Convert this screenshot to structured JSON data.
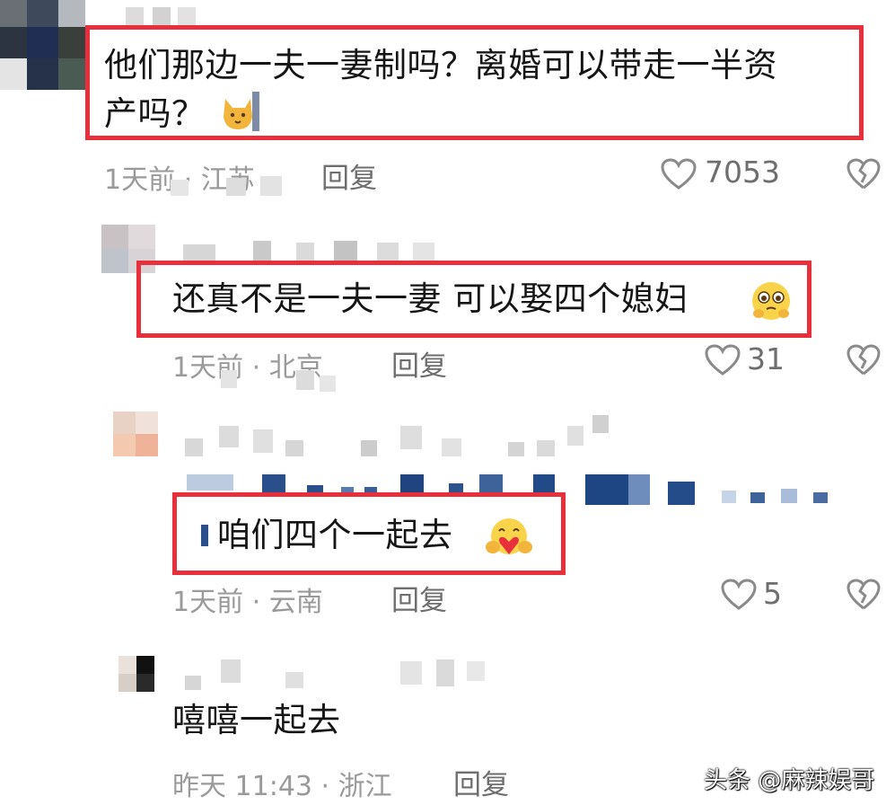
{
  "comments": [
    {
      "text_line1": "他们那边一夫一妻制吗？离婚可以带走一半资",
      "text_line2": "产吗？",
      "time_location": "1天前 · 江苏",
      "reply_label": "回复",
      "likes": "7053"
    },
    {
      "text": "还真不是一夫一妻 可以娶四个媳妇",
      "time_location": "1天前 · 北京",
      "reply_label": "回复",
      "likes": "31"
    },
    {
      "text": "咱们四个一起去",
      "time_location": "1天前 · 云南",
      "reply_label": "回复",
      "likes": "5"
    },
    {
      "text": "嘻嘻一起去",
      "time_location": "昨天 11:43 · 浙江",
      "reply_label": "回复"
    }
  ],
  "watermark": {
    "text": "头条 @麻辣娱哥"
  },
  "colors": {
    "highlight": "#e8303c",
    "meta_text": "#9a9a9a",
    "icon": "#8a8a8a"
  },
  "icons": [
    "heart-outline-icon",
    "broken-heart-icon",
    "cat-emoji",
    "pleading-face-emoji",
    "hugging-heart-emoji"
  ]
}
